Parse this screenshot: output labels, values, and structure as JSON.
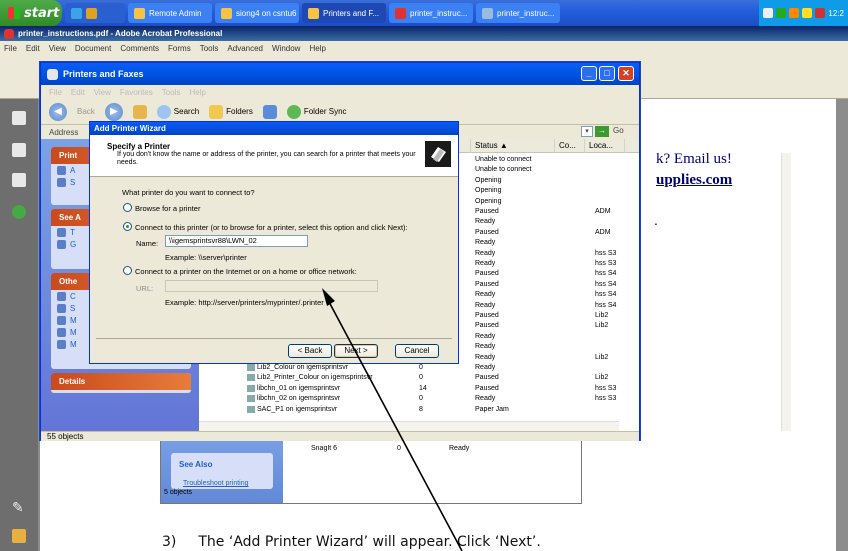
{
  "taskbar": {
    "start_label": "start",
    "items": [
      "Remote Admin",
      "siong4 on csntu6",
      "Printers and F...",
      "printer_instruc...",
      "printer_instruc..."
    ],
    "clock": "12:2"
  },
  "acrobat": {
    "title": "printer_instructions.pdf - Adobe Acrobat Professional",
    "menu": [
      "File",
      "Edit",
      "View",
      "Document",
      "Comments",
      "Forms",
      "Tools",
      "Advanced",
      "Window",
      "Help"
    ]
  },
  "document": {
    "ad_line1": "k? Email us!",
    "ad_line2": "upplies.com",
    "bullet": ".",
    "step_number": "3)",
    "step_text": "The ‘Add Printer Wizard’ will appear. Click ‘Next’.",
    "embedded": {
      "row_name": "SnagIt 6",
      "row_docs": "0",
      "row_status": "Ready",
      "see_also": "See Also",
      "troubleshoot": "Troubleshoot printing",
      "status": "5 objects"
    }
  },
  "explorer": {
    "title": "Printers and Faxes",
    "menu": [
      "File",
      "Edit",
      "View",
      "Favorites",
      "Tools",
      "Help"
    ],
    "toolbar": {
      "back": "Back",
      "search": "Search",
      "folders": "Folders",
      "folder_sync": "Folder Sync"
    },
    "address_label": "Address",
    "go_label": "Go",
    "left_panel": {
      "printer_tasks": "Print",
      "see_also": "See A",
      "other": "Othe",
      "details": "Details"
    },
    "columns": {
      "status": "Status ▲",
      "comments": "Co...",
      "location": "Loca..."
    },
    "rows": [
      {
        "status": "Unable to connect",
        "location": ""
      },
      {
        "status": "Unable to connect",
        "location": ""
      },
      {
        "status": "Opening",
        "location": ""
      },
      {
        "status": "Opening",
        "location": ""
      },
      {
        "status": "Opening",
        "location": ""
      },
      {
        "status": "Paused",
        "location": "ADM"
      },
      {
        "status": "Ready",
        "location": ""
      },
      {
        "status": "Paused",
        "location": "ADM"
      },
      {
        "status": "Ready",
        "location": ""
      },
      {
        "status": "Ready",
        "location": "hss S3"
      },
      {
        "status": "Ready",
        "location": "hss S3"
      },
      {
        "status": "Paused",
        "location": "hss S4"
      },
      {
        "status": "Paused",
        "location": "hss S4"
      },
      {
        "status": "Ready",
        "location": "hss S4"
      },
      {
        "status": "Ready",
        "location": "hss S4"
      },
      {
        "status": "Paused",
        "location": "Lib2"
      },
      {
        "status": "Paused",
        "location": "Lib2"
      },
      {
        "status": "Ready",
        "location": ""
      },
      {
        "status": "Ready",
        "location": ""
      },
      {
        "status": "Ready",
        "location": "Lib2"
      },
      {
        "status": "Ready",
        "location": ""
      },
      {
        "status": "Paused",
        "location": "Lib2"
      },
      {
        "status": "Paused",
        "location": "hss S3"
      },
      {
        "status": "Ready",
        "location": "hss S3"
      },
      {
        "status": "Paper Jam",
        "location": ""
      }
    ],
    "named_rows": [
      {
        "name": "Lib2_Colour on igemsprintsvr",
        "docs": "0"
      },
      {
        "name": "Lib2_Printer_Colour on igemsprintsvr",
        "docs": "0"
      },
      {
        "name": "libchn_01 on igemsprintsvr",
        "docs": "14"
      },
      {
        "name": "libchn_02 on igemsprintsvr",
        "docs": "0"
      },
      {
        "name": "SAC_P1 on igemsprintsvr",
        "docs": "8"
      }
    ],
    "status_bar": "55 objects"
  },
  "wizard": {
    "title": "Add Printer Wizard",
    "header_title": "Specify a Printer",
    "header_desc": "If you don't know the name or address of the printer, you can search for a printer that meets your needs.",
    "question": "What printer do you want to connect to?",
    "opt_browse": "Browse for a printer",
    "opt_connect": "Connect to this printer (or to browse for a printer, select this option and click Next):",
    "name_label": "Name:",
    "name_value": "\\\\igemsprintsvr88\\LWN_02",
    "name_example": "Example: \\\\server\\printer",
    "opt_internet": "Connect to a printer on the Internet or on a home or office network:",
    "url_label": "URL:",
    "url_value": "",
    "url_example": "Example: http://server/printers/myprinter/.printer",
    "btn_back": "< Back",
    "btn_next": "Next >",
    "btn_cancel": "Cancel"
  }
}
